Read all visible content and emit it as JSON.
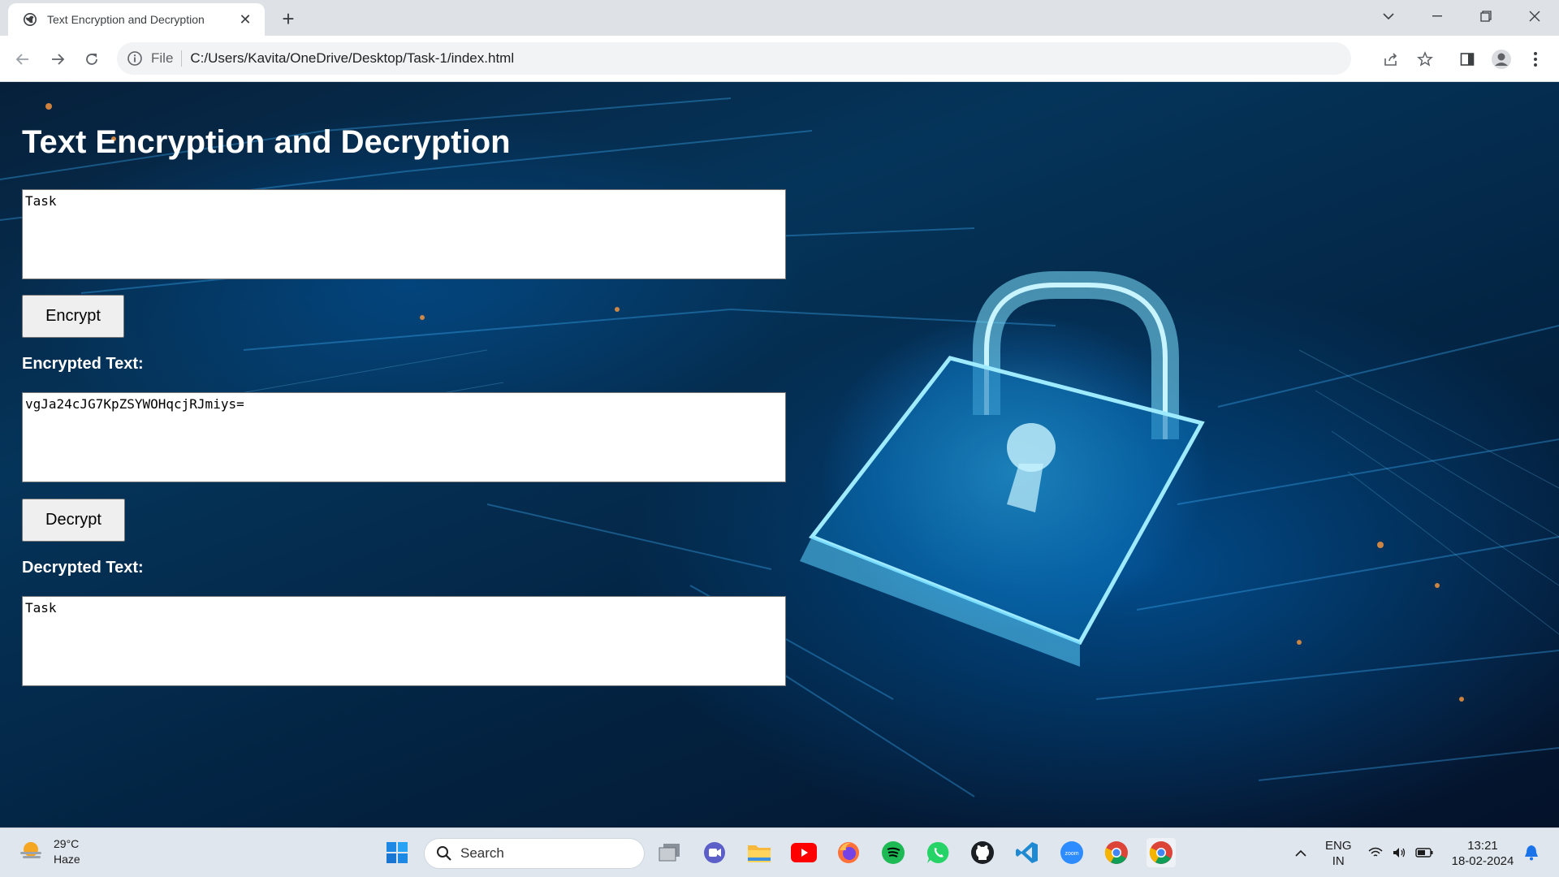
{
  "browser": {
    "tab_title": "Text Encryption and Decryption",
    "address_scheme": "File",
    "address_url": "C:/Users/Kavita/OneDrive/Desktop/Task-1/index.html"
  },
  "app": {
    "heading": "Text Encryption and Decryption",
    "input_text": "Task",
    "encrypt_label": "Encrypt",
    "encrypted_label": "Encrypted Text:",
    "encrypted_value": "vgJa24cJG7KpZSYWOHqcjRJmiys=",
    "decrypt_label": "Decrypt",
    "decrypted_label": "Decrypted Text:",
    "decrypted_value": "Task"
  },
  "taskbar": {
    "weather_temp": "29°C",
    "weather_desc": "Haze",
    "search_placeholder": "Search",
    "lang_top": "ENG",
    "lang_bottom": "IN",
    "time": "13:21",
    "date": "18-02-2024",
    "apps": [
      "start-icon",
      "task-view-icon",
      "meet-icon",
      "file-explorer-icon",
      "youtube-icon",
      "firefox-icon",
      "spotify-icon",
      "whatsapp-icon",
      "github-icon",
      "vscode-icon",
      "zoom-icon",
      "chrome-icon",
      "chrome-active-icon"
    ]
  },
  "colors": {
    "page_bg": "#05345a",
    "heading": "#ffffff",
    "taskbar": "#dfe6ee"
  }
}
